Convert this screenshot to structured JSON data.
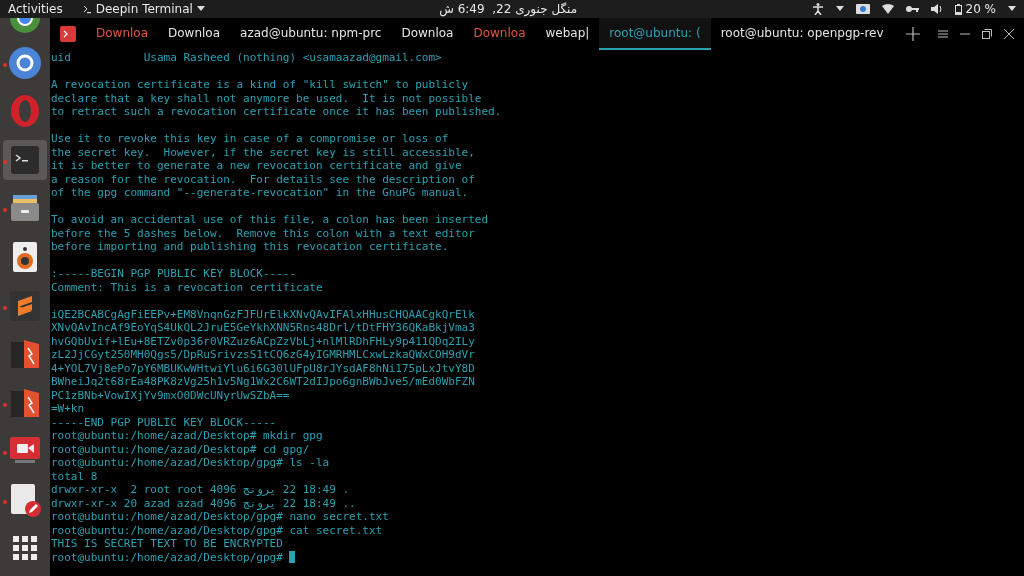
{
  "top_bar": {
    "activities": "Activities",
    "app_menu": "Deepin Terminal",
    "clock": "منگل جنوری 22,  6:49 ش",
    "battery": "20 %"
  },
  "dock": [
    {
      "kind": "chrome",
      "running": false,
      "selected": false
    },
    {
      "kind": "chromium",
      "running": true,
      "selected": false
    },
    {
      "kind": "opera",
      "running": false,
      "selected": false
    },
    {
      "kind": "terminal",
      "running": true,
      "selected": true
    },
    {
      "kind": "files",
      "running": true,
      "selected": false
    },
    {
      "kind": "speaker",
      "running": false,
      "selected": false
    },
    {
      "kind": "sublime",
      "running": true,
      "selected": false
    },
    {
      "kind": "bolt",
      "running": false,
      "selected": false
    },
    {
      "kind": "bolt",
      "running": true,
      "selected": false
    },
    {
      "kind": "recorder",
      "running": true,
      "selected": false
    },
    {
      "kind": "editor",
      "running": true,
      "selected": false
    },
    {
      "kind": "apps",
      "running": false,
      "selected": false
    }
  ],
  "tabs": [
    {
      "label": "Downloa",
      "selected": false,
      "color": "#e0573f"
    },
    {
      "label": "Downloa",
      "selected": false,
      "color": "#e6e6e6"
    },
    {
      "label": "azad@ubuntu: npm-prc",
      "selected": false,
      "color": "#e6e6e6"
    },
    {
      "label": "Downloa",
      "selected": false,
      "color": "#e6e6e6"
    },
    {
      "label": "Downloa",
      "selected": false,
      "color": "#e0573f"
    },
    {
      "label": "webap|",
      "selected": false,
      "color": "#e6e6e6"
    },
    {
      "label": "root@ubuntu: (",
      "selected": true,
      "color": "#2aa1b3"
    },
    {
      "label": "root@ubuntu: openpgp-rev",
      "selected": false,
      "color": "#e6e6e6"
    }
  ],
  "terminal": {
    "blocks": [
      [
        "uid           Usama Rasheed (nothing) <usamaazad@gmail.com>"
      ],
      [
        "A revocation certificate is a kind of \"kill switch\" to publicly",
        "declare that a key shall not anymore be used.  It is not possible",
        "to retract such a revocation certificate once it has been published."
      ],
      [
        "Use it to revoke this key in case of a compromise or loss of",
        "the secret key.  However, if the secret key is still accessible,",
        "it is better to generate a new revocation certificate and give",
        "a reason for the revocation.  For details see the description of",
        "of the gpg command \"--generate-revocation\" in the GnuPG manual."
      ],
      [
        "To avoid an accidental use of this file, a colon has been inserted",
        "before the 5 dashes below.  Remove this colon with a text editor",
        "before importing and publishing this revocation certificate."
      ],
      [
        ":-----BEGIN PGP PUBLIC KEY BLOCK-----",
        "Comment: This is a revocation certificate"
      ],
      [
        "iQE2BCABCgAgFiEEPv+EM8VnqnGzFJFUrElkXNvQAvIFAlxHHusCHQAACgkQrElk",
        "XNvQAvIncAf9EoYqS4UkQL2JruE5GeYkhXNN5Rns48Drl/tDtFHY36QKaBkjVma3",
        "hvGQbUvif+lEu+8ETZv0p36r0VRZuz6ACpZzVbLj+nlMlRDhFHLy9p411QDq2ILy",
        "zL2JjCGyt250MH0Qgs5/DpRuSrivzsS1tCQ6zG4yIGMRHMLCxwLzkaQWxCOH9dVr",
        "4+YOL7Vj8ePo7pY6MBUKwWHtwiYlu6i6G30lUFpU8rJYsdAF8hNi175pLxJtvY8D",
        "BWheiJq2t68rEa48PK8zVg25h1v5Ng1Wx2C6WT2dIJpo6gnBWbJve5/mEd0WbFZN",
        "PC1zBNb+VowIXjYv9mxO0DWcUNyrUwSZbA==",
        "=W+kn",
        "-----END PGP PUBLIC KEY BLOCK-----",
        "root@ubuntu:/home/azad/Desktop# mkdir gpg",
        "root@ubuntu:/home/azad/Desktop# cd gpg/",
        "root@ubuntu:/home/azad/Desktop/gpg# ls -la",
        "total 8",
        "drwxr-xr-x  2 root root 4096 جنوری 22 18:49 .",
        "drwxr-xr-x 20 azad azad 4096 جنوری 22 18:49 ..",
        "root@ubuntu:/home/azad/Desktop/gpg# nano secret.txt",
        "root@ubuntu:/home/azad/Desktop/gpg# cat secret.txt",
        "THIS IS SECRET TEXT TO BE ENCRYPTED"
      ]
    ],
    "prompt": "root@ubuntu:/home/azad/Desktop/gpg# "
  }
}
